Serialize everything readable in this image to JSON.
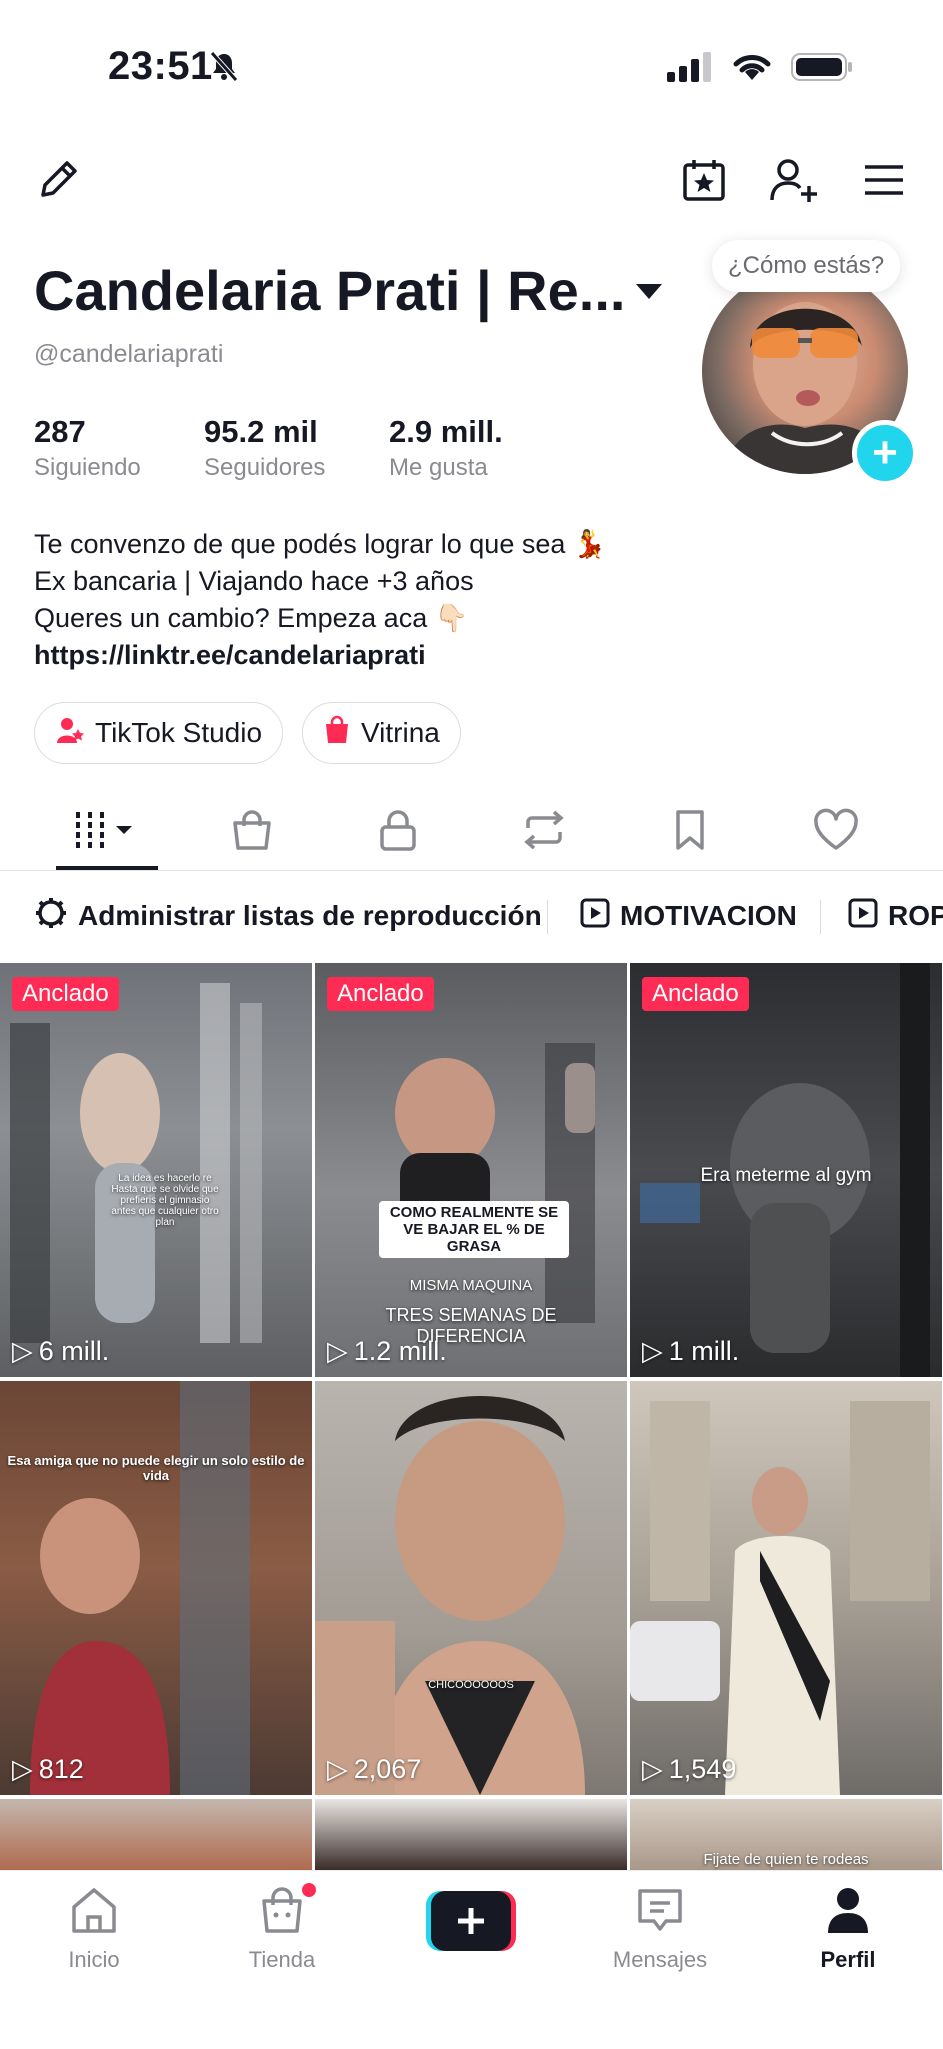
{
  "status_bar": {
    "time": "23:51"
  },
  "profile": {
    "display_name": "Candelaria Prati | Re...",
    "username": "@candelariaprati",
    "greeting_bubble": "¿Cómo estás?",
    "stats": [
      {
        "value": "287",
        "label": "Siguiendo"
      },
      {
        "value": "95.2 mil",
        "label": "Seguidores"
      },
      {
        "value": "2.9 mill.",
        "label": "Me gusta"
      }
    ],
    "bio": [
      "Te convenzo de que podés lograr lo que sea 💃",
      "Ex bancaria | Viajando hace +3 años",
      "Queres un cambio? Empeza aca 👇🏻"
    ],
    "link": "https://linktr.ee/candelariaprati",
    "buttons": {
      "studio": "TikTok Studio",
      "showcase": "Vitrina"
    }
  },
  "playlists": {
    "manage": "Administrar listas de reproducción",
    "items": [
      "MOTIVACION",
      "ROP"
    ]
  },
  "videos": [
    {
      "pinned": "Anclado",
      "views": "6 mill.",
      "caption": "La idea es hacerlo re Hasta que se olvide que prefieris el gimnasio antes que cualquier otro plan"
    },
    {
      "pinned": "Anclado",
      "views": "1.2 mill.",
      "caption": "COMO REALMENTE SE VE BAJAR EL % DE GRASA",
      "caption2": "MISMA MAQUINA",
      "caption3": "TRES SEMANAS DE DIFERENCIA"
    },
    {
      "pinned": "Anclado",
      "views": "1 mill.",
      "caption": "Era meterme al gym"
    },
    {
      "views": "812",
      "caption": "Esa amiga que no puede elegir un solo estilo de vida"
    },
    {
      "views": "2,067",
      "caption": "CHICOOOOOOS"
    },
    {
      "views": "1,549"
    },
    {},
    {},
    {
      "caption": "Fijate de quien te rodeas"
    }
  ],
  "bottom_nav": {
    "home": "Inicio",
    "shop": "Tienda",
    "messages": "Mensajes",
    "profile": "Perfil"
  },
  "colors": {
    "accent_red": "#fe2c55",
    "accent_cyan": "#20d5ec",
    "text": "#161823",
    "muted": "#8a8b91"
  }
}
